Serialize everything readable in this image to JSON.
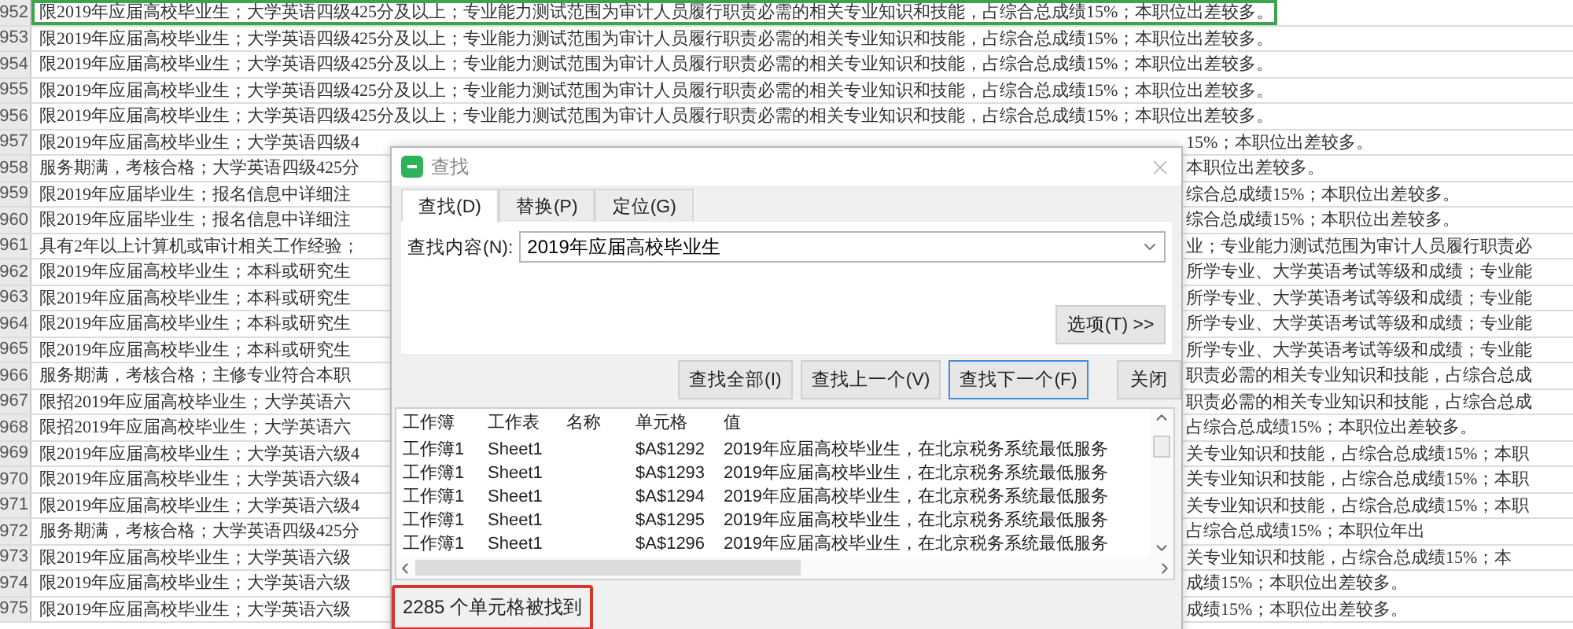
{
  "sheet": {
    "rows": [
      {
        "number": "952",
        "selected": true,
        "text": "限2019年应届高校毕业生；大学英语四级425分及以上；专业能力测试范围为审计人员履行职责必需的相关专业知识和技能，占综合总成绩15%；本职位出差较多。"
      },
      {
        "number": "953",
        "selected": false,
        "text": "限2019年应届高校毕业生；大学英语四级425分及以上；专业能力测试范围为审计人员履行职责必需的相关专业知识和技能，占综合总成绩15%；本职位出差较多。"
      },
      {
        "number": "954",
        "selected": false,
        "text": "限2019年应届高校毕业生；大学英语四级425分及以上；专业能力测试范围为审计人员履行职责必需的相关专业知识和技能，占综合总成绩15%；本职位出差较多。"
      },
      {
        "number": "955",
        "selected": false,
        "text": "限2019年应届高校毕业生；大学英语四级425分及以上；专业能力测试范围为审计人员履行职责必需的相关专业知识和技能，占综合总成绩15%；本职位出差较多。"
      },
      {
        "number": "956",
        "selected": false,
        "text": "限2019年应届高校毕业生；大学英语四级425分及以上；专业能力测试范围为审计人员履行职责必需的相关专业知识和技能，占综合总成绩15%；本职位出差较多。"
      },
      {
        "number": "957",
        "selected": false,
        "left": "限2019年应届高校毕业生；大学英语四级4",
        "right": "15%；本职位出差较多。"
      },
      {
        "number": "958",
        "selected": false,
        "left": "服务期满，考核合格；大学英语四级425分",
        "right": "本职位出差较多。"
      },
      {
        "number": "959",
        "selected": false,
        "left": "限2019年应届毕业生；报名信息中详细注",
        "right": "综合总成绩15%；本职位出差较多。"
      },
      {
        "number": "960",
        "selected": false,
        "left": "限2019年应届毕业生；报名信息中详细注",
        "right": "综合总成绩15%；本职位出差较多。"
      },
      {
        "number": "961",
        "selected": false,
        "left": "具有2年以上计算机或审计相关工作经验；",
        "right": "业；专业能力测试范围为审计人员履行职责必"
      },
      {
        "number": "962",
        "selected": false,
        "left": "限2019年应届高校毕业生；本科或研究生",
        "right": "所学专业、大学英语考试等级和成绩；专业能"
      },
      {
        "number": "963",
        "selected": false,
        "left": "限2019年应届高校毕业生；本科或研究生",
        "right": "所学专业、大学英语考试等级和成绩；专业能"
      },
      {
        "number": "964",
        "selected": false,
        "left": "限2019年应届高校毕业生；本科或研究生",
        "right": "所学专业、大学英语考试等级和成绩；专业能"
      },
      {
        "number": "965",
        "selected": false,
        "left": "限2019年应届高校毕业生；本科或研究生",
        "right": "所学专业、大学英语考试等级和成绩；专业能"
      },
      {
        "number": "966",
        "selected": false,
        "left": "服务期满，考核合格；主修专业符合本职",
        "right": "职责必需的相关专业知识和技能，占综合总成"
      },
      {
        "number": "967",
        "selected": false,
        "left": "限招2019年应届高校毕业生；大学英语六",
        "right": "职责必需的相关专业知识和技能，占综合总成"
      },
      {
        "number": "968",
        "selected": false,
        "left": "限招2019年应届高校毕业生；大学英语六",
        "right": "占综合总成绩15%；本职位出差较多。"
      },
      {
        "number": "969",
        "selected": false,
        "left": "限2019年应届高校毕业生；大学英语六级4",
        "right": "关专业知识和技能，占综合总成绩15%；本职"
      },
      {
        "number": "970",
        "selected": false,
        "left": "限2019年应届高校毕业生；大学英语六级4",
        "right": "关专业知识和技能，占综合总成绩15%；本职"
      },
      {
        "number": "971",
        "selected": false,
        "left": "限2019年应届高校毕业生；大学英语六级4",
        "right": "关专业知识和技能，占综合总成绩15%；本职"
      },
      {
        "number": "972",
        "selected": false,
        "left": "服务期满，考核合格；大学英语四级425分",
        "right": "占综合总成绩15%；本职位年出"
      },
      {
        "number": "973",
        "selected": false,
        "left": "限2019年应届高校毕业生；大学英语六级",
        "right": "关专业知识和技能，占综合总成绩15%；本"
      },
      {
        "number": "974",
        "selected": false,
        "left": "限2019年应届高校毕业生；大学英语六级",
        "right": "成绩15%；本职位出差较多。"
      },
      {
        "number": "975",
        "selected": false,
        "left": "限2019年应届高校毕业生；大学英语六级",
        "right": "成绩15%；本职位出差较多。"
      }
    ]
  },
  "find_dialog": {
    "title": "查找",
    "tabs": [
      {
        "label": "查找(D)",
        "selected": true
      },
      {
        "label": "替换(P)",
        "selected": false
      },
      {
        "label": "定位(G)",
        "selected": false
      }
    ],
    "field_label": "查找内容(N):",
    "field_value": "2019年应届高校毕业生",
    "options_button": "选项(T) >>",
    "buttons": [
      {
        "label": "查找全部(I)",
        "focused": false
      },
      {
        "label": "查找上一个(V)",
        "focused": false
      },
      {
        "label": "查找下一个(F)",
        "focused": true
      }
    ],
    "close_button": "关闭",
    "results": {
      "columns": [
        "工作簿",
        "工作表",
        "名称",
        "单元格",
        "值"
      ],
      "rows": [
        {
          "workbook": "工作簿1",
          "sheet": "Sheet1",
          "cell": "$A$1292",
          "value": "2019年应届高校毕业生，在北京税务系统最低服务"
        },
        {
          "workbook": "工作簿1",
          "sheet": "Sheet1",
          "cell": "$A$1293",
          "value": "2019年应届高校毕业生，在北京税务系统最低服务"
        },
        {
          "workbook": "工作簿1",
          "sheet": "Sheet1",
          "cell": "$A$1294",
          "value": "2019年应届高校毕业生，在北京税务系统最低服务"
        },
        {
          "workbook": "工作簿1",
          "sheet": "Sheet1",
          "cell": "$A$1295",
          "value": "2019年应届高校毕业生，在北京税务系统最低服务"
        },
        {
          "workbook": "工作簿1",
          "sheet": "Sheet1",
          "cell": "$A$1296",
          "value": "2019年应届高校毕业生，在北京税务系统最低服务"
        }
      ]
    },
    "status": "2285 个单元格被找到"
  }
}
